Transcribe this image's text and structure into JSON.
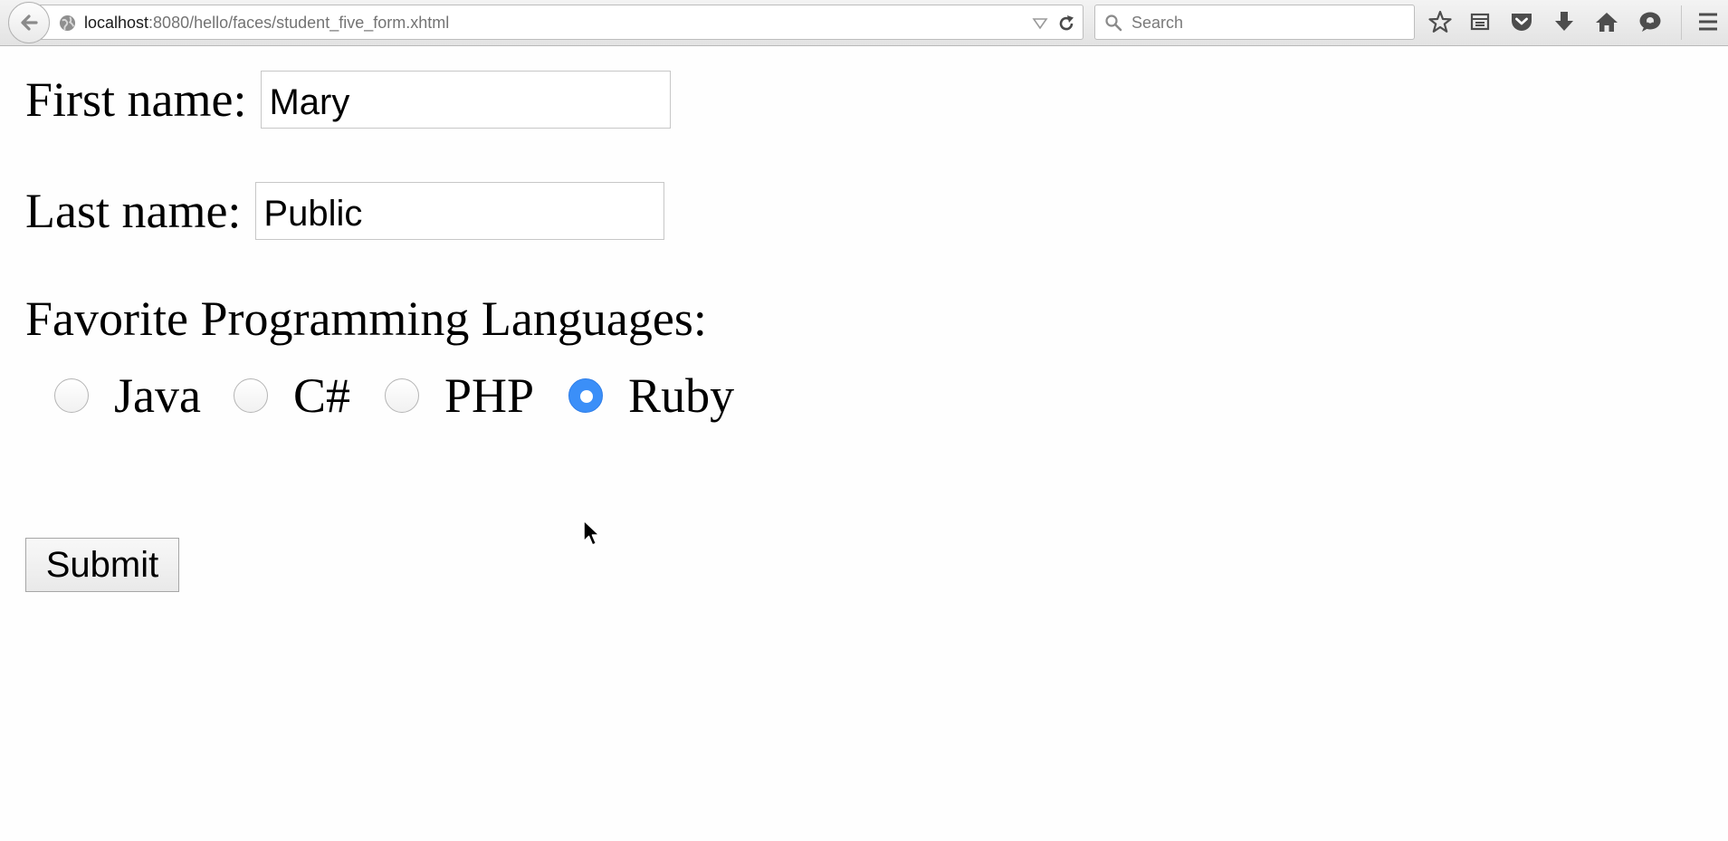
{
  "browser": {
    "url_host": "localhost",
    "url_path": ":8080/hello/faces/student_five_form.xhtml",
    "search_placeholder": "Search",
    "icons": [
      "back-arrow-icon",
      "globe-icon",
      "dropdown-arrow-icon",
      "reload-icon",
      "search-icon",
      "bookmark-star-icon",
      "reading-list-icon",
      "pocket-icon",
      "download-icon",
      "home-icon",
      "chat-icon",
      "hamburger-menu-icon"
    ]
  },
  "form": {
    "first_name_label": "First name:",
    "first_name_value": "Mary",
    "last_name_label": "Last name:",
    "last_name_value": "Public",
    "languages_label": "Favorite Programming Languages:",
    "languages": [
      {
        "label": "Java",
        "checked": false
      },
      {
        "label": "C#",
        "checked": false
      },
      {
        "label": "PHP",
        "checked": false
      },
      {
        "label": "Ruby",
        "checked": true
      }
    ],
    "submit_label": "Submit"
  },
  "colors": {
    "radio_checked": "#3b8ff8",
    "toolbar_bg": "#e8e8e8"
  }
}
